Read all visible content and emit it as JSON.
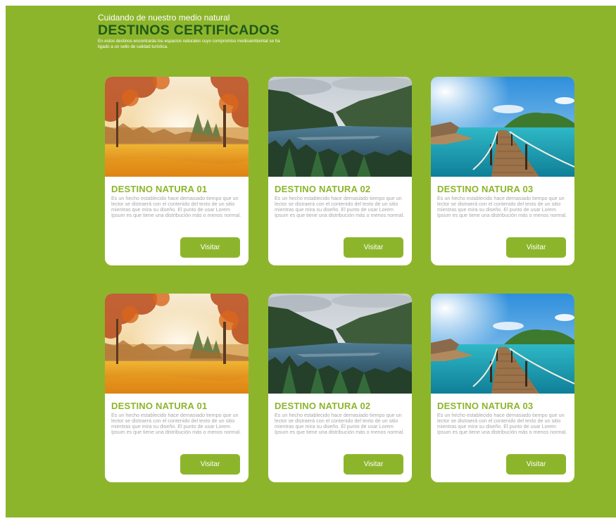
{
  "header": {
    "eyebrow": "Cuidando de nuestro medio natural",
    "title": "DESTINOS CERTIFICADOS",
    "lead": "En estos destinos encontrarás los espacios naturales cuyo compromiso medioambiental se ha ligado a un sello de calidad turística."
  },
  "cards": [
    {
      "title": "DESTINO NATURA 01",
      "image": "autumn-forest-image",
      "text": "Es un hecho establecido hace demasiado tiempo que un lector se distraerá con el contenido del texto de un sitio mientras que mira su diseño. El punto de usar Lorem Ipsum es que tiene una distribución más o menos normal.",
      "button": "Visitar"
    },
    {
      "title": "DESTINO NATURA 02",
      "image": "mountain-lake-image",
      "text": "Es un hecho establecido hace demasiado tiempo que un lector se distraerá con el contenido del texto de un sitio mientras que mira su diseño. El punto de usar Lorem Ipsum es que tiene una distribución más o menos normal.",
      "button": "Visitar"
    },
    {
      "title": "DESTINO NATURA 03",
      "image": "tropical-pier-image",
      "text": "Es un hecho establecido hace demasiado tiempo que un lector se distraerá con el contenido del texto de un sitio mientras que mira su diseño. El punto de usar Lorem Ipsum es que tiene una distribución más o menos normal.",
      "button": "Visitar"
    },
    {
      "title": "DESTINO NATURA 01",
      "image": "autumn-forest-image",
      "text": "Es un hecho establecido hace demasiado tiempo que un lector se distraerá con el contenido del texto de un sitio mientras que mira su diseño. El punto de usar Lorem Ipsum es que tiene una distribución más o menos normal.",
      "button": "Visitar"
    },
    {
      "title": "DESTINO NATURA 02",
      "image": "mountain-lake-image",
      "text": "Es un hecho establecido hace demasiado tiempo que un lector se distraerá con el contenido del texto de un sitio mientras que mira su diseño. El punto de usar Lorem Ipsum es que tiene una distribución más o menos normal.",
      "button": "Visitar"
    },
    {
      "title": "DESTINO NATURA 03",
      "image": "tropical-pier-image",
      "text": "Es un hecho establecido hace demasiado tiempo que un lector se distraerá con el contenido del texto de un sitio mientras que mira su diseño. El punto de usar Lorem Ipsum es que tiene una distribución más o menos normal.",
      "button": "Visitar"
    }
  ],
  "colors": {
    "background": "#8db52c",
    "title": "#1f5a18",
    "card": "#ffffff",
    "body_text": "#a6a6a6"
  }
}
